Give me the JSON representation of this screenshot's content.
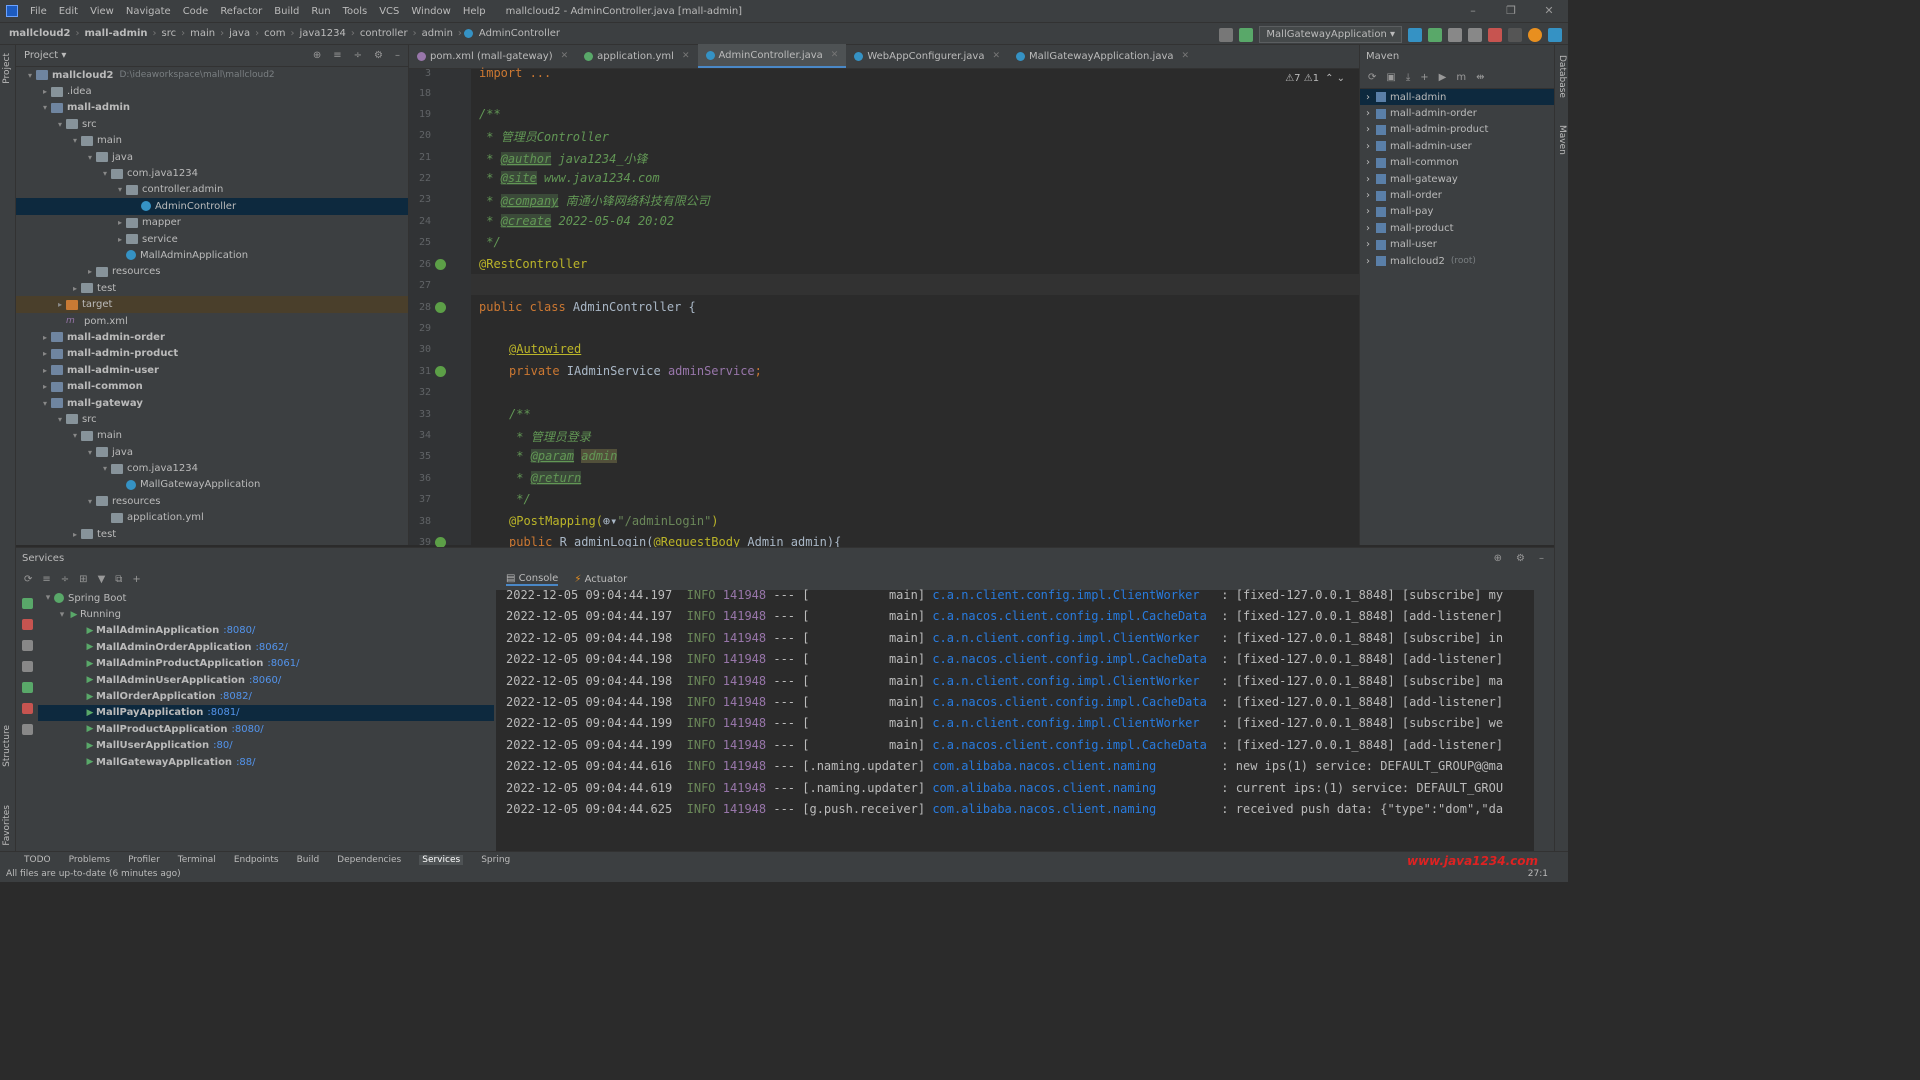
{
  "menubar": {
    "items": [
      "File",
      "Edit",
      "View",
      "Navigate",
      "Code",
      "Refactor",
      "Build",
      "Run",
      "Tools",
      "VCS",
      "Window",
      "Help"
    ],
    "title": "mallcloud2 - AdminController.java [mall-admin]"
  },
  "navbar": {
    "crumbs": [
      "mallcloud2",
      "mall-admin",
      "src",
      "main",
      "java",
      "com",
      "java1234",
      "controller",
      "admin",
      "AdminController"
    ],
    "run_config": "MallGatewayApplication"
  },
  "project": {
    "title": "Project",
    "rows": [
      {
        "label": "mallcloud2",
        "dim": "D:\\ideaworkspace\\mall\\mallcloud2",
        "level": 0,
        "arrow": "▾",
        "icon": "foldm",
        "bold": true
      },
      {
        "label": ".idea",
        "level": 1,
        "arrow": "▸",
        "icon": "fold"
      },
      {
        "label": "mall-admin",
        "level": 1,
        "arrow": "▾",
        "icon": "foldm",
        "bold": true
      },
      {
        "label": "src",
        "level": 2,
        "arrow": "▾",
        "icon": "fold"
      },
      {
        "label": "main",
        "level": 3,
        "arrow": "▾",
        "icon": "fold"
      },
      {
        "label": "java",
        "level": 4,
        "arrow": "▾",
        "icon": "fold"
      },
      {
        "label": "com.java1234",
        "level": 5,
        "arrow": "▾",
        "icon": "fold"
      },
      {
        "label": "controller.admin",
        "level": 6,
        "arrow": "▾",
        "icon": "fold"
      },
      {
        "label": "AdminController",
        "level": 7,
        "arrow": "",
        "icon": "cls",
        "sel": true
      },
      {
        "label": "mapper",
        "level": 6,
        "arrow": "▸",
        "icon": "fold"
      },
      {
        "label": "service",
        "level": 6,
        "arrow": "▸",
        "icon": "fold"
      },
      {
        "label": "MallAdminApplication",
        "level": 6,
        "arrow": "",
        "icon": "cls"
      },
      {
        "label": "resources",
        "level": 4,
        "arrow": "▸",
        "icon": "fold"
      },
      {
        "label": "test",
        "level": 3,
        "arrow": "▸",
        "icon": "fold"
      },
      {
        "label": "target",
        "level": 2,
        "arrow": "▸",
        "icon": "foldo",
        "tgt": true
      },
      {
        "label": "pom.xml",
        "level": 2,
        "arrow": "",
        "icon": "xml"
      },
      {
        "label": "mall-admin-order",
        "level": 1,
        "arrow": "▸",
        "icon": "foldm",
        "bold": true
      },
      {
        "label": "mall-admin-product",
        "level": 1,
        "arrow": "▸",
        "icon": "foldm",
        "bold": true
      },
      {
        "label": "mall-admin-user",
        "level": 1,
        "arrow": "▸",
        "icon": "foldm",
        "bold": true
      },
      {
        "label": "mall-common",
        "level": 1,
        "arrow": "▸",
        "icon": "foldm",
        "bold": true
      },
      {
        "label": "mall-gateway",
        "level": 1,
        "arrow": "▾",
        "icon": "foldm",
        "bold": true
      },
      {
        "label": "src",
        "level": 2,
        "arrow": "▾",
        "icon": "fold"
      },
      {
        "label": "main",
        "level": 3,
        "arrow": "▾",
        "icon": "fold"
      },
      {
        "label": "java",
        "level": 4,
        "arrow": "▾",
        "icon": "fold"
      },
      {
        "label": "com.java1234",
        "level": 5,
        "arrow": "▾",
        "icon": "fold"
      },
      {
        "label": "MallGatewayApplication",
        "level": 6,
        "arrow": "",
        "icon": "cls"
      },
      {
        "label": "resources",
        "level": 4,
        "arrow": "▾",
        "icon": "fold"
      },
      {
        "label": "application.yml",
        "level": 5,
        "arrow": "",
        "icon": "fold"
      },
      {
        "label": "test",
        "level": 3,
        "arrow": "▸",
        "icon": "fold"
      }
    ]
  },
  "editor": {
    "tabs": [
      {
        "label": "pom.xml (mall-gateway)",
        "active": false
      },
      {
        "label": "application.yml",
        "active": false
      },
      {
        "label": "AdminController.java",
        "active": true
      },
      {
        "label": "WebAppConfigurer.java",
        "active": false
      },
      {
        "label": "MallGatewayApplication.java",
        "active": false
      }
    ],
    "inspections": "⚠7  ⚠1",
    "line_numbers": [
      "3",
      "18",
      "19",
      "20",
      "21",
      "22",
      "23",
      "24",
      "25",
      "26",
      "27",
      "28",
      "29",
      "30",
      "31",
      "32",
      "33",
      "34",
      "35",
      "36",
      "37",
      "38",
      "39"
    ],
    "code": {
      "l3": "import ...",
      "l19": "/**",
      "l20a": " * ",
      "l20b": "管理员Controller",
      "l21a": " * ",
      "l21tag": "@author",
      "l21b": " java1234_小锋",
      "l22a": " * ",
      "l22tag": "@site",
      "l22b": " www.java1234.com",
      "l23a": " * ",
      "l23tag": "@company",
      "l23b": " 南通小锋网络科技有限公司",
      "l24a": " * ",
      "l24tag": "@create",
      "l24b": " 2022-05-04 20:02",
      "l25": " */",
      "l26": "@RestController",
      "l28kw": "public class ",
      "l28": "AdminController {",
      "l30": "@Autowired",
      "l31kw": "private ",
      "l31t": "IAdminService ",
      "l31f": "adminService",
      "l31e": ";",
      "l33": "/**",
      "l34a": " * ",
      "l34b": "管理员登录",
      "l35a": " * ",
      "l35tag": "@param",
      "l35p": "admin",
      "l36a": " * ",
      "l36tag": "@return",
      "l37": " */",
      "l38a": "@PostMapping(",
      "l38b": "\"/adminLogin\"",
      "l38c": ")",
      "l39kw": "public ",
      "l39": "R adminLogin(",
      "l39ann": "@RequestBody ",
      "l39e": "Admin admin){"
    }
  },
  "maven": {
    "title": "Maven",
    "items": [
      {
        "label": "mall-admin",
        "sel": true
      },
      {
        "label": "mall-admin-order"
      },
      {
        "label": "mall-admin-product"
      },
      {
        "label": "mall-admin-user"
      },
      {
        "label": "mall-common"
      },
      {
        "label": "mall-gateway"
      },
      {
        "label": "mall-order"
      },
      {
        "label": "mall-pay"
      },
      {
        "label": "mall-product"
      },
      {
        "label": "mall-user"
      },
      {
        "label": "mallcloud2",
        "dim": "(root)"
      }
    ]
  },
  "services": {
    "title": "Services",
    "spring_boot": "Spring Boot",
    "running": "Running",
    "apps": [
      {
        "name": "MallAdminApplication",
        "port": ":8080/"
      },
      {
        "name": "MallAdminOrderApplication",
        "port": ":8062/"
      },
      {
        "name": "MallAdminProductApplication",
        "port": ":8061/"
      },
      {
        "name": "MallAdminUserApplication",
        "port": ":8060/"
      },
      {
        "name": "MallOrderApplication",
        "port": ":8082/"
      },
      {
        "name": "MallPayApplication",
        "port": ":8081/",
        "sel": true
      },
      {
        "name": "MallProductApplication",
        "port": ":8080/"
      },
      {
        "name": "MallUserApplication",
        "port": ":80/"
      },
      {
        "name": "MallGatewayApplication",
        "port": ":88/"
      }
    ]
  },
  "console": {
    "tabs": [
      "Console",
      "Actuator"
    ],
    "lines": [
      {
        "ts": "2022-12-05 09:04:44.197",
        "lv": "INFO",
        "pid": "141948",
        "sep": "--- [",
        "th": "           main]",
        "lg": "c.a.n.client.config.impl.ClientWorker  ",
        "msg": " : [fixed-127.0.0.1_8848] [subscribe] my"
      },
      {
        "ts": "2022-12-05 09:04:44.197",
        "lv": "INFO",
        "pid": "141948",
        "sep": "--- [",
        "th": "           main]",
        "lg": "c.a.nacos.client.config.impl.CacheData ",
        "msg": " : [fixed-127.0.0.1_8848] [add-listener]"
      },
      {
        "ts": "2022-12-05 09:04:44.198",
        "lv": "INFO",
        "pid": "141948",
        "sep": "--- [",
        "th": "           main]",
        "lg": "c.a.n.client.config.impl.ClientWorker  ",
        "msg": " : [fixed-127.0.0.1_8848] [subscribe] in"
      },
      {
        "ts": "2022-12-05 09:04:44.198",
        "lv": "INFO",
        "pid": "141948",
        "sep": "--- [",
        "th": "           main]",
        "lg": "c.a.nacos.client.config.impl.CacheData ",
        "msg": " : [fixed-127.0.0.1_8848] [add-listener]"
      },
      {
        "ts": "2022-12-05 09:04:44.198",
        "lv": "INFO",
        "pid": "141948",
        "sep": "--- [",
        "th": "           main]",
        "lg": "c.a.n.client.config.impl.ClientWorker  ",
        "msg": " : [fixed-127.0.0.1_8848] [subscribe] ma"
      },
      {
        "ts": "2022-12-05 09:04:44.198",
        "lv": "INFO",
        "pid": "141948",
        "sep": "--- [",
        "th": "           main]",
        "lg": "c.a.nacos.client.config.impl.CacheData ",
        "msg": " : [fixed-127.0.0.1_8848] [add-listener]"
      },
      {
        "ts": "2022-12-05 09:04:44.199",
        "lv": "INFO",
        "pid": "141948",
        "sep": "--- [",
        "th": "           main]",
        "lg": "c.a.n.client.config.impl.ClientWorker  ",
        "msg": " : [fixed-127.0.0.1_8848] [subscribe] we"
      },
      {
        "ts": "2022-12-05 09:04:44.199",
        "lv": "INFO",
        "pid": "141948",
        "sep": "--- [",
        "th": "           main]",
        "lg": "c.a.nacos.client.config.impl.CacheData ",
        "msg": " : [fixed-127.0.0.1_8848] [add-listener]"
      },
      {
        "ts": "2022-12-05 09:04:44.616",
        "lv": "INFO",
        "pid": "141948",
        "sep": "--- [",
        "th": ".naming.updater]",
        "lg": "com.alibaba.nacos.client.naming        ",
        "msg": " : new ips(1) service: DEFAULT_GROUP@@ma"
      },
      {
        "ts": "2022-12-05 09:04:44.619",
        "lv": "INFO",
        "pid": "141948",
        "sep": "--- [",
        "th": ".naming.updater]",
        "lg": "com.alibaba.nacos.client.naming        ",
        "msg": " : current ips:(1) service: DEFAULT_GROU"
      },
      {
        "ts": "2022-12-05 09:04:44.625",
        "lv": "INFO",
        "pid": "141948",
        "sep": "--- [",
        "th": "g.push.receiver]",
        "lg": "com.alibaba.nacos.client.naming        ",
        "msg": " : received push data: {\"type\":\"dom\",\"da"
      }
    ]
  },
  "statusbar": {
    "tool_windows": [
      {
        "label": "TODO"
      },
      {
        "label": "Problems"
      },
      {
        "label": "Profiler"
      },
      {
        "label": "Terminal"
      },
      {
        "label": "Endpoints"
      },
      {
        "label": "Build"
      },
      {
        "label": "Dependencies"
      },
      {
        "label": "Services",
        "active": true
      },
      {
        "label": "Spring"
      }
    ],
    "message": "All files are up-to-date (6 minutes ago)",
    "position": "27:1",
    "watermark": "www.java1234.com"
  },
  "strips": {
    "left": [
      "Project",
      "Structure",
      "Favorites"
    ],
    "right": [
      "Database",
      "Maven"
    ]
  }
}
